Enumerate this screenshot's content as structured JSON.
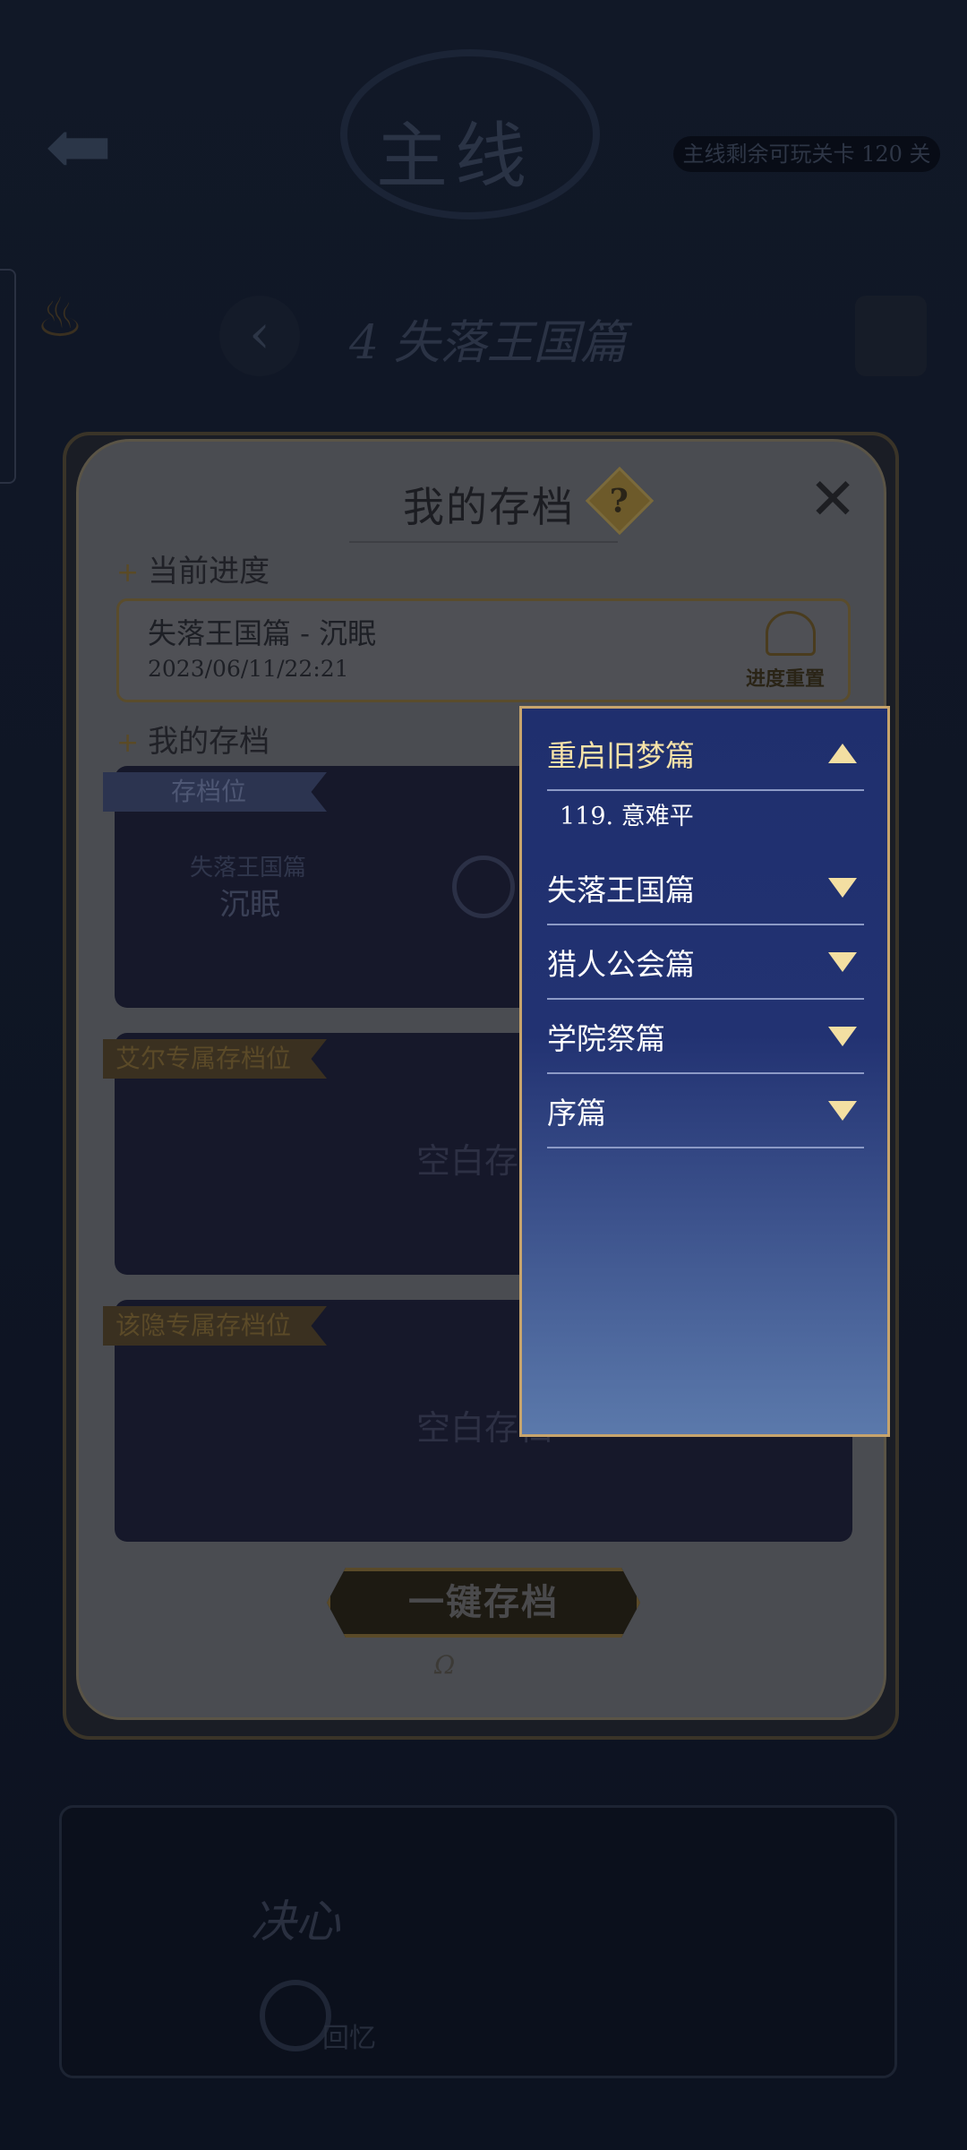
{
  "background": {
    "back_glyph": "⬅",
    "header_title": "主线",
    "remaining_text": "主线剩余可玩关卡 120 关",
    "side_icon_glyph": "♨",
    "chapter_prev_glyph": "‹",
    "chapter_title": "4 失落王国篇",
    "resolve_text": "决心",
    "memory_text": "回忆"
  },
  "dialog": {
    "title": "我的存档",
    "help_glyph": "?",
    "close_glyph": "✕",
    "current_progress_label": "当前进度",
    "current_progress": {
      "name": "失落王国篇 - 沉眠",
      "time": "2023/06/11/22:21",
      "reset_label": "进度重置"
    },
    "my_saves_label": "我的存档",
    "slots": [
      {
        "tag": "存档位",
        "chapter": "失落王国篇",
        "stage": "沉眠"
      },
      {
        "tag": "艾尔专属存档位",
        "empty_text": "空白存档"
      },
      {
        "tag": "该隐专属存档位",
        "empty_text": "空白存档"
      }
    ],
    "one_click_save": "一键存档"
  },
  "dropdown": {
    "expanded_group": "重启旧梦篇",
    "expanded_sub_item": "119. 意难平",
    "groups": [
      "失落王国篇",
      "猎人公会篇",
      "学院祭篇",
      "序篇"
    ]
  },
  "colors": {
    "dropdown_border": "#c7a46c",
    "dropdown_top": "#1f2f6e",
    "dropdown_bottom": "#5b79ab",
    "arrow_gold": "#f3dfa2"
  }
}
